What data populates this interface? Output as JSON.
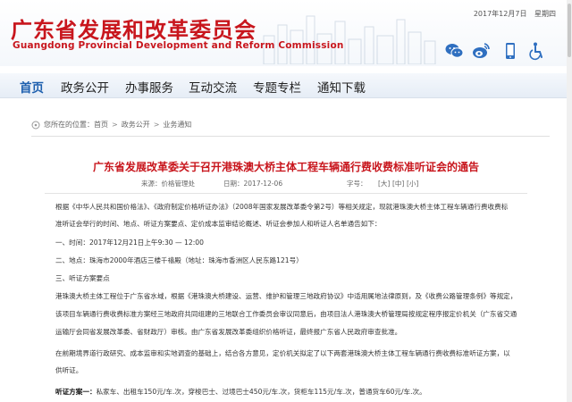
{
  "header": {
    "site_title": "广东省发展和改革委员会",
    "site_subtitle": "Guangdong Provincial Development and Reform Commission",
    "date": "2017年12月7日",
    "weekday": "星期四"
  },
  "icons": {
    "wechat": "wechat-icon",
    "weibo": "weibo-icon",
    "mobile": "mobile-icon",
    "accessibility": "accessibility-icon"
  },
  "nav": {
    "items": [
      {
        "label": "首页"
      },
      {
        "label": "政务公开"
      },
      {
        "label": "办事服务"
      },
      {
        "label": "互动交流"
      },
      {
        "label": "专题专栏"
      },
      {
        "label": "通知下载"
      }
    ]
  },
  "breadcrumb": {
    "prefix": "您所在的位置：",
    "items": [
      "首页",
      "政务公开",
      "业务通知"
    ]
  },
  "article": {
    "title": "广东省发展改革委关于召开港珠澳大桥主体工程车辆通行费收费标准听证会的通告",
    "source": "来源：价格管理处",
    "date": "日期：2017-12-06",
    "font_size": "字号：",
    "font_large": "[大]",
    "font_medium": "[中]",
    "font_small": "[小]",
    "paragraphs": [
      "根据《中华人民共和国价格法》、《政府制定价格听证办法》（2008年国家发展改革委令第2号）等相关规定，现就港珠澳大桥主体工程车辆通行费收费标",
      "准听证会举行的时间、地点、听证方案要点、定价成本监审结论概述、听证会参加人和听证人名单通告如下：",
      "一、时间：2017年12月21日上午9:30 — 12:00",
      "二、地点：珠海市2000年酒店三楼千禧殿（地址：珠海市香洲区人民东路121号）",
      "三、听证方案要点",
      "港珠澳大桥主体工程位于广东省水域，根据《港珠澳大桥建设、运营、维护和管理三地政府协议》中适用属地法律原则，及《收费公路管理条例》等规定，",
      "该项目车辆通行费收费标准方案经三地政府共同组建的三地联合工作委员会审议同意后，由项目法人港珠澳大桥管理局按规定程序报定价机关（广东省交通",
      "运输厅会同省发展改革委、省财政厅）审核。由广东省发展改革委组织价格听证，最终报广东省人民政府审查批准。",
      "在前期境界道行政研究、成本监审和实地调查的基础上，结合各方意见，定价机关拟定了以下两套港珠澳大桥主体工程车辆通行费收费标准听证方案，以",
      "供听证。"
    ],
    "plan_label": "听证方案一：",
    "plan_text": "私家车、出租车150元/车.次，穿梭巴士、过境巴士450元/车.次，货柜车115元/车.次，普通货车60元/车.次。"
  }
}
